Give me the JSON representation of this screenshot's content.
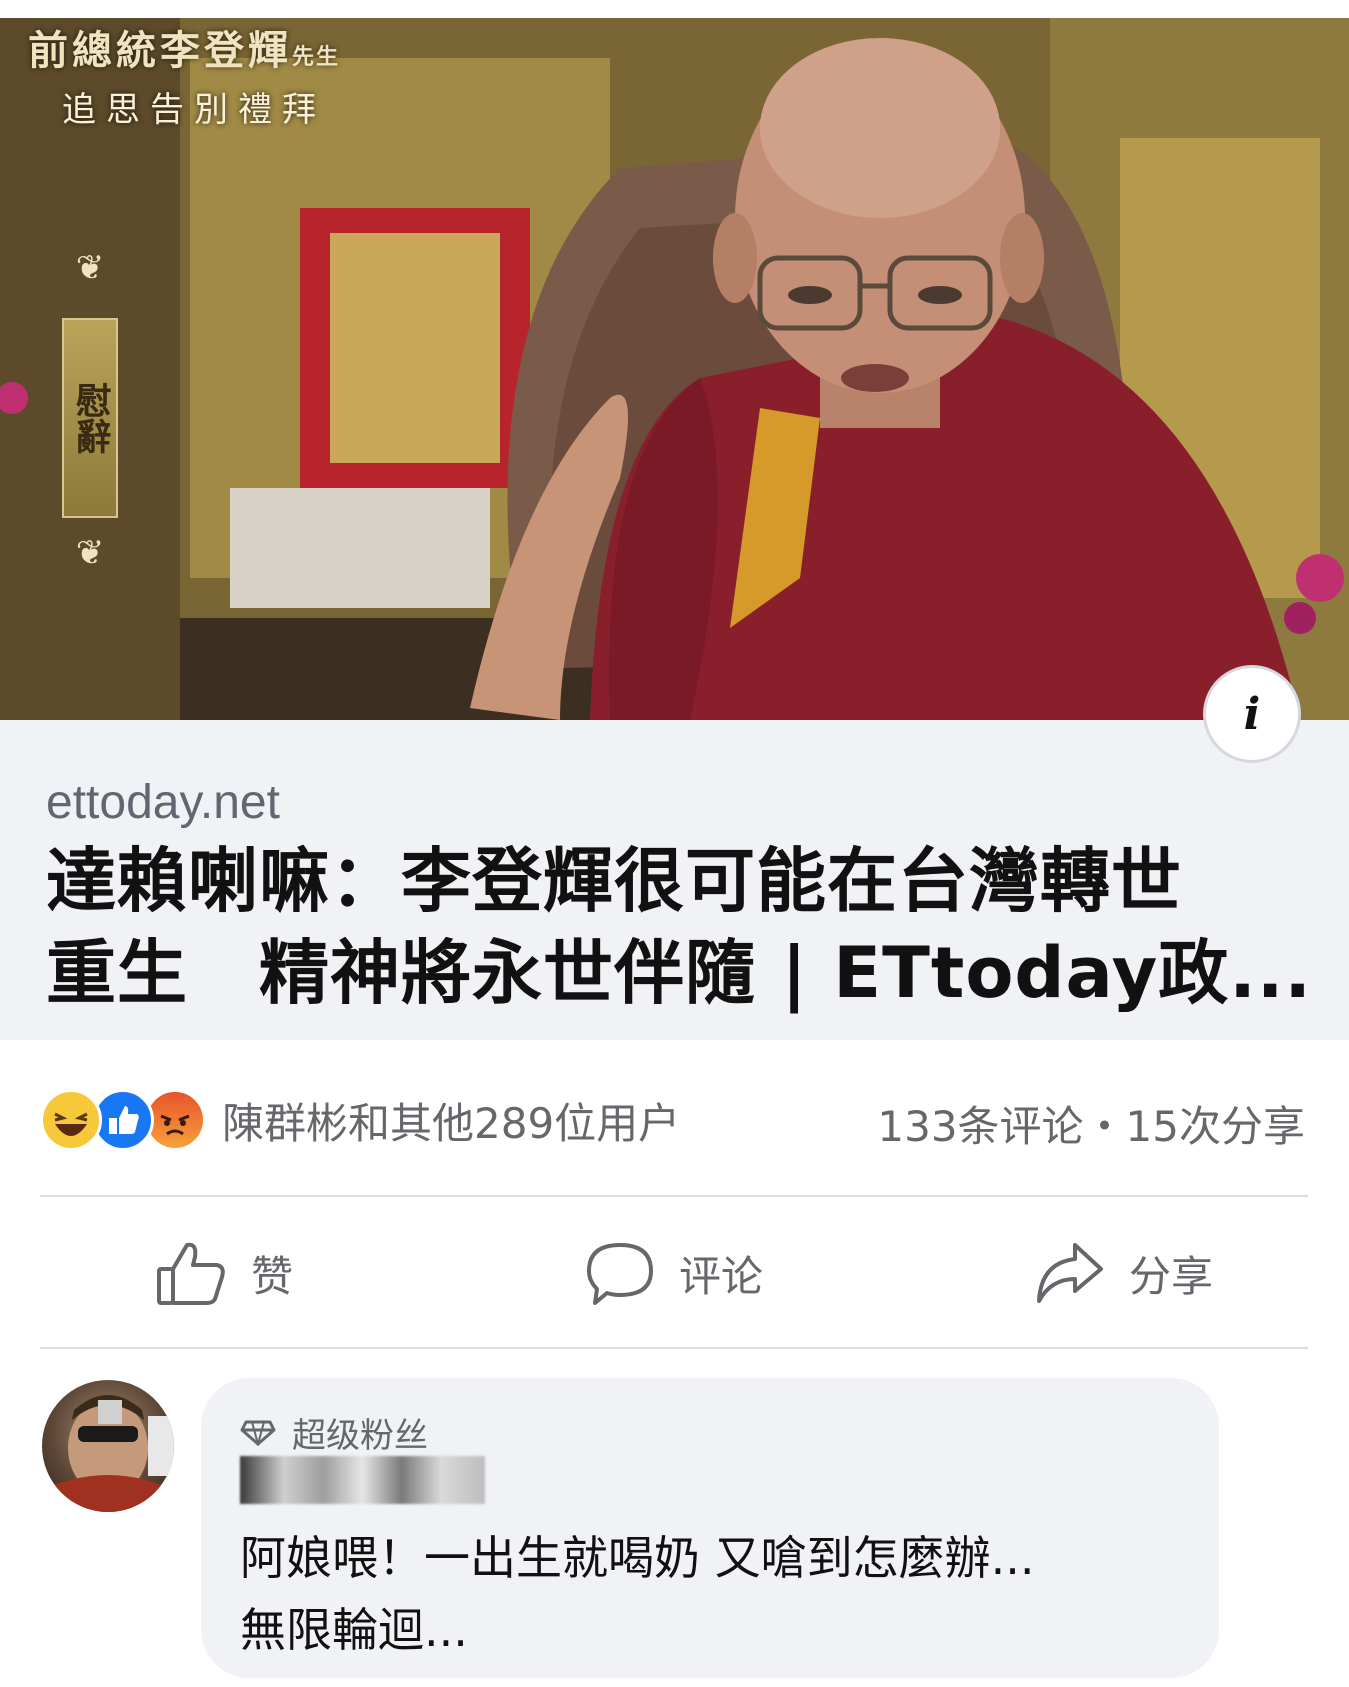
{
  "hero": {
    "memorial_title": "前總統李登輝",
    "memorial_title_suffix": "先生",
    "memorial_subtitle": "追思告別禮拜",
    "condolence_label": "慰辭",
    "info_icon": "i"
  },
  "link_preview": {
    "domain": "ettoday.net",
    "headline_line1": "達賴喇嘛：李登輝很可能在台灣轉世",
    "headline_line2": "重生　精神將永世伴隨 | ETtoday政..."
  },
  "reactions": {
    "icons": [
      "haha-reaction-icon",
      "like-reaction-icon",
      "angry-reaction-icon"
    ],
    "summary": "陳群彬和其他289位用户",
    "stats": "133条评论・15次分享"
  },
  "actions": {
    "like_label": "赞",
    "comment_label": "评论",
    "share_label": "分享"
  },
  "comment": {
    "badge": "超级粉丝",
    "text_line1": "阿娘喂！一出生就喝奶 又嗆到怎麼辦...",
    "text_line2": "無限輪迴..."
  },
  "colors": {
    "link_box_bg": "#f0f2f5",
    "secondary_text": "#65676b",
    "like_blue": "#1877f2",
    "robe_maroon": "#8a1f2c"
  }
}
